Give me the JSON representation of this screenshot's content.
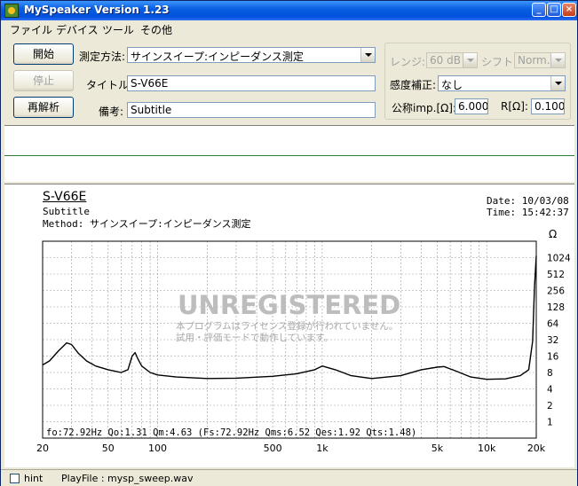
{
  "window": {
    "title": "MySpeaker Version 1.23"
  },
  "menu": [
    "ファイル",
    "デバイス",
    "ツール",
    "その他"
  ],
  "buttons": {
    "start": "開始",
    "stop": "停止",
    "reanalyze": "再解析"
  },
  "form": {
    "method_label": "測定方法:",
    "method_value": "サインスイープ:インピーダンス測定",
    "title_label": "タイトル:",
    "title_value": "S-V66E",
    "note_label": "備考:",
    "note_value": "Subtitle",
    "range_label": "レンジ:",
    "range_value": "60 dB",
    "shift_label": "シフト:",
    "shift_value": "Norm.",
    "sens_label": "感度補正:",
    "sens_value": "なし",
    "imp_label": "公称imp.[Ω]:",
    "imp_value": "6.000",
    "r_label": "R[Ω]:",
    "r_value": "0.100"
  },
  "chart_header": {
    "title": "S-V66E",
    "subtitle": "Subtitle",
    "method": "Method: サインスイープ:インピーダンス測定",
    "date": "Date: 10/03/08",
    "time": "Time: 15:42:37"
  },
  "watermark": {
    "line1": "UNREGISTERED",
    "line2": "本プログラムはライセンス登録が行われていません。",
    "line3": "試用・評価モードで動作しています。"
  },
  "params": "fo:72.92Hz  Qo:1.31 Qm:4.63  (Fs:72.92Hz  Qms:6.52 Qes:1.92 Qts:1.48)",
  "chart_data": {
    "type": "line",
    "xscale": "log",
    "yscale": "log",
    "xlim": [
      20,
      20000
    ],
    "ylim": [
      0.5,
      2048
    ],
    "xticks": [
      {
        "v": 20,
        "label": "20"
      },
      {
        "v": 50,
        "label": "50"
      },
      {
        "v": 100,
        "label": "100"
      },
      {
        "v": 500,
        "label": "500"
      },
      {
        "v": 1000,
        "label": "1k"
      },
      {
        "v": 5000,
        "label": "5k"
      },
      {
        "v": 10000,
        "label": "10k"
      },
      {
        "v": 20000,
        "label": "20k"
      }
    ],
    "yticks": [
      1,
      2,
      4,
      8,
      16,
      32,
      64,
      128,
      256,
      512,
      1024
    ],
    "ylabel_unit": "Ω",
    "x": [
      20,
      22,
      25,
      28,
      30,
      33,
      37,
      42,
      50,
      60,
      66,
      70,
      73,
      76,
      80,
      90,
      100,
      130,
      200,
      300,
      500,
      700,
      900,
      1000,
      1200,
      1500,
      2000,
      3000,
      4000,
      5000,
      5500,
      6500,
      8000,
      10000,
      13000,
      16000,
      18000,
      19000,
      19500,
      20000
    ],
    "y": [
      11,
      13,
      20,
      28,
      26,
      18,
      13,
      10.5,
      9,
      8,
      9,
      16,
      18.5,
      14,
      10.5,
      8,
      7.2,
      6.6,
      6.2,
      6.3,
      6.8,
      7.6,
      9,
      10.5,
      9,
      7,
      6.2,
      7,
      9,
      10,
      10.3,
      8.5,
      6.6,
      6,
      6.1,
      7,
      9,
      30,
      300,
      1100
    ]
  },
  "status": {
    "hint": "hint",
    "playfile": "PlayFile : mysp_sweep.wav"
  }
}
